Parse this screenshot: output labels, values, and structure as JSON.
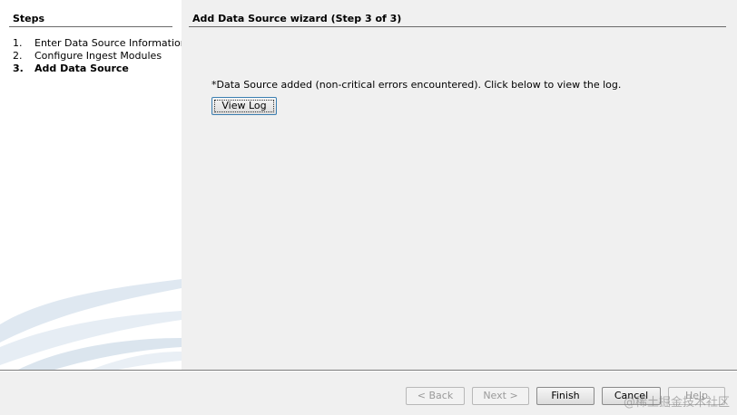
{
  "sidebar": {
    "title": "Steps",
    "steps": [
      {
        "num": "1.",
        "label": "Enter Data Source Information"
      },
      {
        "num": "2.",
        "label": "Configure Ingest Modules"
      },
      {
        "num": "3.",
        "label": "Add Data Source"
      }
    ]
  },
  "main": {
    "title": "Add Data Source wizard (Step 3 of 3)",
    "message": "*Data Source added (non-critical errors encountered). Click below to view the log.",
    "view_log_label": "View Log"
  },
  "footer": {
    "back_label": "< Back",
    "next_label": "Next >",
    "finish_label": "Finish",
    "cancel_label": "Cancel",
    "help_label": "Help"
  },
  "watermark": "@稀土掘金技术社区"
}
